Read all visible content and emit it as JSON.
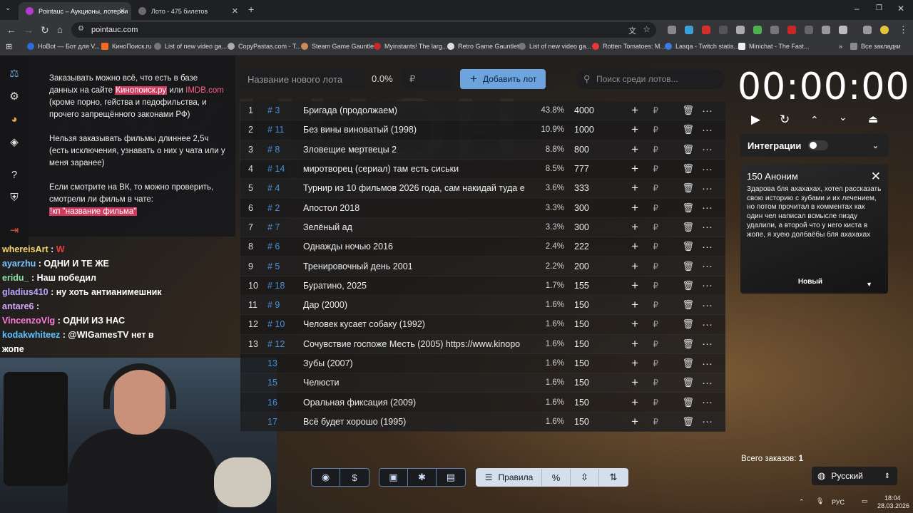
{
  "browser": {
    "tabs": [
      {
        "label": "Pointauc – Аукционы, лотереи",
        "active": true
      },
      {
        "label": "Лото - 475 билетов",
        "active": false
      }
    ],
    "new_tab": "+",
    "url": "pointauc.com",
    "bookmarks": [
      "HoBot — Бот для V...",
      "КиноПоиск.ru",
      "List of new video ga...",
      "CopyPastas.com - T...",
      "Steam Game Gauntlet",
      "Myinstants! The larg...",
      "Retro Game Gauntlet",
      "List of new video ga...",
      "Rotten Tomatoes: M...",
      "Lasqa - Twitch statis...",
      "Minichat - The Fast..."
    ],
    "bookmarks_all": "Все закладки"
  },
  "rules": {
    "p1_a": "Заказывать можно всё, что есть в базе данных на сайте ",
    "link1": "Кинопоиск.ру",
    "p1_b": " или ",
    "link2": "IMDB.com",
    "p1_c": " (кроме порно, гейства и педофильства, и прочего запрещённого законами РФ)",
    "p2": "Нельзя заказывать фильмы длиннее 2,5ч (есть исключения, узнавать о них у чата или у меня заранее)",
    "p3": "Если смотрите на ВК, то можно проверить, смотрели ли фильм в чате:",
    "cmd": "!кп \"название фильма\""
  },
  "chat": [
    {
      "user": "whereisArt",
      "text": "W",
      "color": "#f3d36b",
      "text_color": "#e8403e"
    },
    {
      "user": "ayarzhu",
      "text": "ОДНИ И ТЕ ЖЕ",
      "color": "#7ec6ff",
      "text_color": "#ffffff"
    },
    {
      "user": "eridu_",
      "text": "Наш победил",
      "color": "#8ce0a0",
      "text_color": "#ffffff"
    },
    {
      "user": "gladius410",
      "text": "ну хоть антианимешник",
      "color": "#b9a7ff",
      "text_color": "#ffffff"
    },
    {
      "user": "antare6",
      "text": "",
      "color": "#d6a9ff",
      "text_color": "#ffffff"
    },
    {
      "user": "VincenzoVlg",
      "text": "ОДНИ ИЗ НАС",
      "color": "#ff7ad9",
      "text_color": "#ffffff"
    },
    {
      "user": "kodakwhiteez",
      "text": "@WIGamesTV нет в",
      "color": "#5ec3ff",
      "text_color": "#ffffff"
    },
    {
      "user": "",
      "text": "жопе",
      "color": "#ffffff",
      "text_color": "#ffffff"
    }
  ],
  "lot_form": {
    "name_placeholder": "Название нового лота",
    "percent": "0.0%",
    "amount_placeholder": "₽",
    "add_label": "Добавить лот",
    "search_placeholder": "Поиск среди лотов..."
  },
  "lots": [
    {
      "n": "1",
      "id": "# 3",
      "name": "Бригада (продолжаем)",
      "pct": "43.8%",
      "amount": "4000"
    },
    {
      "n": "2",
      "id": "# 11",
      "name": "Без вины виноватый (1998)",
      "pct": "10.9%",
      "amount": "1000"
    },
    {
      "n": "3",
      "id": "# 8",
      "name": "Зловещие мертвецы 2",
      "pct": "8.8%",
      "amount": "800"
    },
    {
      "n": "4",
      "id": "# 14",
      "name": "миротворец (сериал) там есть сиськи",
      "pct": "8.5%",
      "amount": "777"
    },
    {
      "n": "5",
      "id": "# 4",
      "name": "Турнир из 10 фильмов 2026 года, сам накидай туда е",
      "pct": "3.6%",
      "amount": "333"
    },
    {
      "n": "6",
      "id": "# 2",
      "name": "Апостол 2018",
      "pct": "3.3%",
      "amount": "300"
    },
    {
      "n": "7",
      "id": "# 7",
      "name": "Зелёный ад",
      "pct": "3.3%",
      "amount": "300"
    },
    {
      "n": "8",
      "id": "# 6",
      "name": "Однажды ночью 2016",
      "pct": "2.4%",
      "amount": "222"
    },
    {
      "n": "9",
      "id": "# 5",
      "name": "Тренировочный день 2001",
      "pct": "2.2%",
      "amount": "200"
    },
    {
      "n": "10",
      "id": "# 18",
      "name": "Буратино, 2025",
      "pct": "1.7%",
      "amount": "155"
    },
    {
      "n": "11",
      "id": "# 9",
      "name": "Дар (2000)",
      "pct": "1.6%",
      "amount": "150"
    },
    {
      "n": "12",
      "id": "# 10",
      "name": "Человек кусает собаку (1992)",
      "pct": "1.6%",
      "amount": "150"
    },
    {
      "n": "13",
      "id": "# 12",
      "name": "Сочувствие госпоже Месть (2005) https://www.kinopo",
      "pct": "1.6%",
      "amount": "150"
    },
    {
      "n": "",
      "id": "13",
      "name": "Зубы (2007)",
      "pct": "1.6%",
      "amount": "150"
    },
    {
      "n": "",
      "id": "15",
      "name": "Челюсти",
      "pct": "1.6%",
      "amount": "150"
    },
    {
      "n": "",
      "id": "16",
      "name": "Оральная фиксация (2009)",
      "pct": "1.6%",
      "amount": "150"
    },
    {
      "n": "",
      "id": "17",
      "name": "Всё будет хорошо (1995)",
      "pct": "1.6%",
      "amount": "150"
    }
  ],
  "row_icons": {
    "plus": "+",
    "rub": "₽",
    "delete": "🗑",
    "more": "···"
  },
  "timer": {
    "value": "00:00:00"
  },
  "integrations": {
    "label": "Интеграции"
  },
  "donation": {
    "title": "150 Аноним",
    "text": "Здарова бля ахахахах, хотел рассказать свою историю с зубами и их лечением, но потом прочитал в комментах как один чел написал всмысле пизду удалили, а второй что у него киста в жопе, я хуею долбаёбы бля ахахахах",
    "status": "Новый"
  },
  "orders": {
    "label": "Всего заказов:",
    "count": "1"
  },
  "language": {
    "label": "Русский"
  },
  "toolbar": {
    "rules_label": "Правила",
    "percent": "%"
  },
  "taskbar": {
    "lang": "РУС",
    "time": "18:04",
    "date": "28.03.2026"
  },
  "colors": {
    "accent": "#6ea4dd",
    "id_link": "#4a8fd8",
    "rules_highlight": "#d03a5e"
  }
}
